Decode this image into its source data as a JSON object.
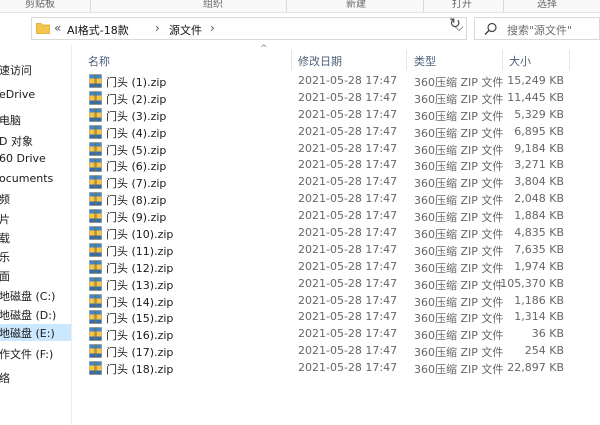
{
  "ribbon": {
    "groups": [
      "剪贴板",
      "组织",
      "新建",
      "打开",
      "选择"
    ]
  },
  "address": {
    "back_chevrons": "«",
    "crumbs": [
      "AI格式-18款",
      "源文件"
    ],
    "separator": "›",
    "dropdown": "⌵",
    "refresh": "↻"
  },
  "search": {
    "placeholder": "搜索\"源文件\""
  },
  "nav": {
    "items": [
      {
        "label": "速访问",
        "selected": false
      },
      {
        "label": "eDrive",
        "selected": false
      },
      {
        "label": "电脑",
        "selected": false
      },
      {
        "label": "D 对象",
        "selected": false
      },
      {
        "label": "60 Drive",
        "selected": false
      },
      {
        "label": "ocuments",
        "selected": false
      },
      {
        "label": "频",
        "selected": false
      },
      {
        "label": "片",
        "selected": false
      },
      {
        "label": "载",
        "selected": false
      },
      {
        "label": "乐",
        "selected": false
      },
      {
        "label": "面",
        "selected": false
      },
      {
        "label": "地磁盘 (C:)",
        "selected": false
      },
      {
        "label": "地磁盘 (D:)",
        "selected": false
      },
      {
        "label": "地磁盘 (E:)",
        "selected": true
      },
      {
        "label": "作文件 (F:)",
        "selected": false
      },
      {
        "label": "络",
        "selected": false
      }
    ]
  },
  "columns": {
    "name": "名称",
    "date": "修改日期",
    "type": "类型",
    "size": "大小",
    "sort_indicator": "^"
  },
  "files": [
    {
      "name": "门头 (1).zip",
      "date": "2021-05-28 17:47",
      "type": "360压缩 ZIP 文件",
      "size": "15,249 KB"
    },
    {
      "name": "门头 (2).zip",
      "date": "2021-05-28 17:47",
      "type": "360压缩 ZIP 文件",
      "size": "11,445 KB"
    },
    {
      "name": "门头 (3).zip",
      "date": "2021-05-28 17:47",
      "type": "360压缩 ZIP 文件",
      "size": "5,329 KB"
    },
    {
      "name": "门头 (4).zip",
      "date": "2021-05-28 17:47",
      "type": "360压缩 ZIP 文件",
      "size": "6,895 KB"
    },
    {
      "name": "门头 (5).zip",
      "date": "2021-05-28 17:47",
      "type": "360压缩 ZIP 文件",
      "size": "9,184 KB"
    },
    {
      "name": "门头 (6).zip",
      "date": "2021-05-28 17:47",
      "type": "360压缩 ZIP 文件",
      "size": "3,271 KB"
    },
    {
      "name": "门头 (7).zip",
      "date": "2021-05-28 17:47",
      "type": "360压缩 ZIP 文件",
      "size": "3,804 KB"
    },
    {
      "name": "门头 (8).zip",
      "date": "2021-05-28 17:47",
      "type": "360压缩 ZIP 文件",
      "size": "2,048 KB"
    },
    {
      "name": "门头 (9).zip",
      "date": "2021-05-28 17:47",
      "type": "360压缩 ZIP 文件",
      "size": "1,884 KB"
    },
    {
      "name": "门头 (10).zip",
      "date": "2021-05-28 17:47",
      "type": "360压缩 ZIP 文件",
      "size": "4,835 KB"
    },
    {
      "name": "门头 (11).zip",
      "date": "2021-05-28 17:47",
      "type": "360压缩 ZIP 文件",
      "size": "7,635 KB"
    },
    {
      "name": "门头 (12).zip",
      "date": "2021-05-28 17:47",
      "type": "360压缩 ZIP 文件",
      "size": "1,974 KB"
    },
    {
      "name": "门头 (13).zip",
      "date": "2021-05-28 17:47",
      "type": "360压缩 ZIP 文件",
      "size": "105,370 KB"
    },
    {
      "name": "门头 (14).zip",
      "date": "2021-05-28 17:47",
      "type": "360压缩 ZIP 文件",
      "size": "1,186 KB"
    },
    {
      "name": "门头 (15).zip",
      "date": "2021-05-28 17:47",
      "type": "360压缩 ZIP 文件",
      "size": "1,314 KB"
    },
    {
      "name": "门头 (16).zip",
      "date": "2021-05-28 17:47",
      "type": "360压缩 ZIP 文件",
      "size": "36 KB"
    },
    {
      "name": "门头 (17).zip",
      "date": "2021-05-28 17:47",
      "type": "360压缩 ZIP 文件",
      "size": "254 KB"
    },
    {
      "name": "门头 (18).zip",
      "date": "2021-05-28 17:47",
      "type": "360压缩 ZIP 文件",
      "size": "22,897 KB"
    }
  ],
  "colors": {
    "selection": "#cce8ff",
    "header_text": "#4c607a",
    "folder_yellow": "#f4c64d"
  }
}
